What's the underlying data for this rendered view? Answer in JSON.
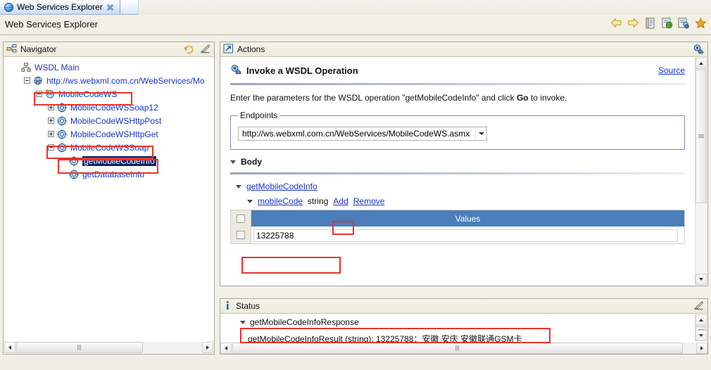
{
  "window": {
    "tab_title": "Web Services Explorer",
    "tab_icon": "globe-icon",
    "close_icon": "close-icon",
    "title_label": "Web Services Explorer"
  },
  "toolbar": {
    "items": [
      {
        "name": "back-icon",
        "label": "Back"
      },
      {
        "name": "forward-icon",
        "label": "Forward"
      },
      {
        "name": "wsdl-page-icon",
        "label": "WSDL Page"
      },
      {
        "name": "web-page-icon",
        "label": "Web Service Page"
      },
      {
        "name": "uddi-page-icon",
        "label": "UDDI Page"
      },
      {
        "name": "favorites-icon",
        "label": "Favorites"
      }
    ]
  },
  "navigator": {
    "title": "Navigator",
    "icon": "navigator-icon",
    "head_icons": [
      {
        "name": "refresh-icon"
      },
      {
        "name": "view-menu-icon"
      }
    ],
    "tree": [
      {
        "label": "WSDL Main",
        "indent": 0,
        "toggle": "none",
        "icon": "wsdl-main-icon",
        "style": "link",
        "highlight": false,
        "boxed": false
      },
      {
        "label": "http://ws.webxml.com.cn/WebServices/Mo",
        "indent": 1,
        "toggle": "minus",
        "icon": "wsdl-service-icon",
        "style": "link",
        "highlight": false,
        "boxed": false
      },
      {
        "label": "MobileCodeWS",
        "indent": 2,
        "toggle": "minus",
        "icon": "wsdl-binding-icon",
        "style": "link",
        "highlight": false,
        "boxed": true
      },
      {
        "label": "MobileCodeWSSoap12",
        "indent": 3,
        "toggle": "plus",
        "icon": "gear-icon",
        "style": "link",
        "highlight": false,
        "boxed": false
      },
      {
        "label": "MobileCodeWSHttpPost",
        "indent": 3,
        "toggle": "plus",
        "icon": "gear-icon",
        "style": "link",
        "highlight": false,
        "boxed": false
      },
      {
        "label": "MobileCodeWSHttpGet",
        "indent": 3,
        "toggle": "plus",
        "icon": "gear-icon",
        "style": "link",
        "highlight": false,
        "boxed": false
      },
      {
        "label": "MobileCodeWSSoap",
        "indent": 3,
        "toggle": "minus",
        "icon": "gear-icon",
        "style": "link",
        "highlight": false,
        "boxed": true
      },
      {
        "label": "getMobileCodeInfo",
        "indent": 4,
        "toggle": "none",
        "icon": "gear-icon",
        "style": "link",
        "highlight": true,
        "boxed": true
      },
      {
        "label": "getDatabaseInfo",
        "indent": 4,
        "toggle": "none",
        "icon": "gear-icon",
        "style": "link",
        "highlight": false,
        "boxed": false
      }
    ],
    "hscroll": {
      "left_arrow": "scroll-left-icon",
      "right_arrow": "scroll-right-icon"
    }
  },
  "actions": {
    "title": "Actions",
    "icon": "actions-icon",
    "head_icon": "actions-menu-icon",
    "heading": "Invoke a WSDL Operation",
    "heading_icon": "invoke-wsdl-icon",
    "source_link": "Source",
    "description_pre": "Enter the parameters for the WSDL operation \"getMobileCodeInfo\" and click ",
    "description_bold": "Go",
    "description_post": " to invoke.",
    "endpoints": {
      "legend": "Endpoints",
      "selected": "http://ws.webxml.com.cn/WebServices/MobileCodeWS.asmx",
      "dropdown_icon": "chevron-down-icon"
    },
    "body_section": {
      "label": "Body",
      "toggle_icon": "triangle-down-icon",
      "operation": "getMobileCodeInfo",
      "param": {
        "name": "mobileCode",
        "type": "string",
        "add_label": "Add",
        "remove_label": "Remove"
      },
      "table": {
        "header_checkbox": "select-all-checkbox",
        "column": "Values",
        "rows": [
          {
            "checkbox": "row-checkbox",
            "value": "13225788"
          }
        ]
      }
    },
    "scrollbar": {
      "up": "scroll-up-icon",
      "down": "scroll-down-icon"
    }
  },
  "status": {
    "title": "Status",
    "icon": "info-icon",
    "head_icon": "status-menu-icon",
    "response_label": "getMobileCodeInfoResponse",
    "toggle_icon": "triangle-down-icon",
    "result_text": "getMobileCodeInfoResult (string): 13225788：安徽 安庆 安徽联通GSM卡",
    "scrollbar": {
      "up": "scroll-up-icon",
      "down": "scroll-down-icon"
    },
    "hscroll": {
      "left_arrow": "scroll-left-icon",
      "right_arrow": "scroll-right-icon"
    }
  },
  "colors": {
    "table_header": "#4a7ebb",
    "selection": "#08246b",
    "link": "#1a33cc",
    "annotation_box": "#e8342a",
    "panel_bg": "#f0f0e8"
  }
}
